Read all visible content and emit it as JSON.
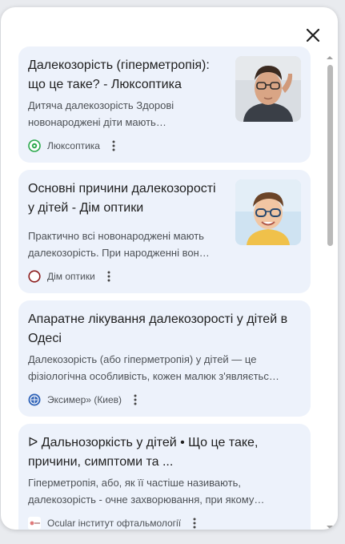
{
  "dialog": {
    "close_icon": "close-icon"
  },
  "results": [
    {
      "title": "Далекозорість (гіперметропія): що це таке? - Люксоптика",
      "snippet_line1": "Дитяча далекозорість Здорові",
      "snippet_line2": "новонароджені діти мають…",
      "source": "Люксоптика",
      "favicon": "luxoptica-logo-icon",
      "thumbnail": "man-adjusting-glasses-image"
    },
    {
      "title": "Основні причини далекозорості у дітей - Дім оптики",
      "snippet_line1": "Практично всі новонароджені мають",
      "snippet_line2": "далекозорість. При народженні вон…",
      "source": "Дім оптики",
      "favicon": "dim-optyky-logo-icon",
      "thumbnail": "boy-with-glasses-image"
    },
    {
      "title": "Апаратне лікування далекозорості у дітей в Одесі",
      "snippet_line1": "Далекозорість (або гіперметропія) у дітей — це",
      "snippet_line2": "фізіологічна особливість, кожен малюк з'являєтьс…",
      "source": "Эксимер» (Киев)",
      "favicon": "eximer-logo-icon"
    },
    {
      "title_line1": "ᐅ Дальнозоркість у дітей • Що це таке,",
      "title_line2": "причини, симптоми та ...",
      "snippet_line1": "Гіперметропія, або, як її частіше називають,",
      "snippet_line2": "далекозорість - очне захворювання, при якому…",
      "source": "Ocular інститут офтальмології",
      "favicon": "ocular-logo-icon"
    }
  ],
  "more_icon": "more-vert-icon",
  "colors": {
    "card_bg": "#edf2fb",
    "title": "#1f1f1f",
    "snippet": "#4d5156",
    "scroll_thumb": "#b9b9b9"
  }
}
